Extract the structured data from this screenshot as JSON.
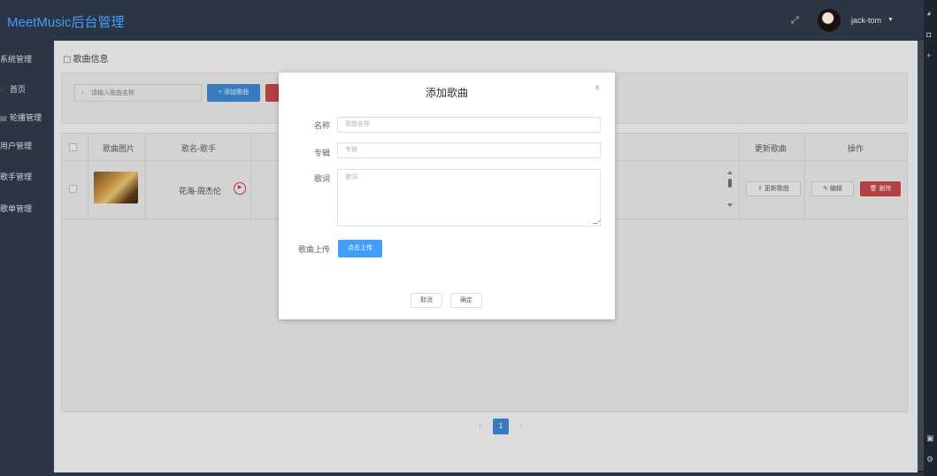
{
  "header": {
    "logo": "MeetMusic后台管理",
    "username": "jack-tom",
    "fullscreen_icon": "fullscreen-icon",
    "caret_icon": "caret-down-icon"
  },
  "sidebar": {
    "items": [
      {
        "label": "系统管理",
        "icon": ""
      },
      {
        "label": "首页",
        "icon": "home-icon"
      },
      {
        "label": "轮播管理",
        "icon": "carousel-icon"
      },
      {
        "label": "用户管理",
        "icon": ""
      },
      {
        "label": "歌手管理",
        "icon": ""
      },
      {
        "label": "歌单管理",
        "icon": ""
      }
    ]
  },
  "main": {
    "breadcrumb": "歌曲信息",
    "search_placeholder": "请输入歌曲名称",
    "add_button": "+ 添加歌曲",
    "table": {
      "headers": [
        "歌曲图片",
        "歌名-歌手",
        "更新歌曲",
        "操作"
      ],
      "rows": [
        {
          "song": "花海-周杰伦",
          "update_label": "⇪ 更新歌曲",
          "edit_label": "✎ 编辑",
          "delete_label": "🗑 删除"
        }
      ]
    },
    "pagination": {
      "current_page": "1",
      "prev": "‹",
      "next": "›"
    }
  },
  "modal": {
    "title": "添加歌曲",
    "close": "×",
    "fields": {
      "name_label": "名称",
      "name_placeholder": "歌曲名称",
      "album_label": "专辑",
      "album_placeholder": "专辑",
      "lyrics_label": "歌词",
      "lyrics_placeholder": "歌词",
      "upload_label": "歌曲上传"
    },
    "upload_button": "点击上传",
    "cancel_button": "取消",
    "confirm_button": "确定"
  },
  "colors": {
    "primary": "#409eff",
    "danger": "#f56c6c",
    "sidebar_bg": "#2b3543",
    "logo": "#409eff"
  }
}
